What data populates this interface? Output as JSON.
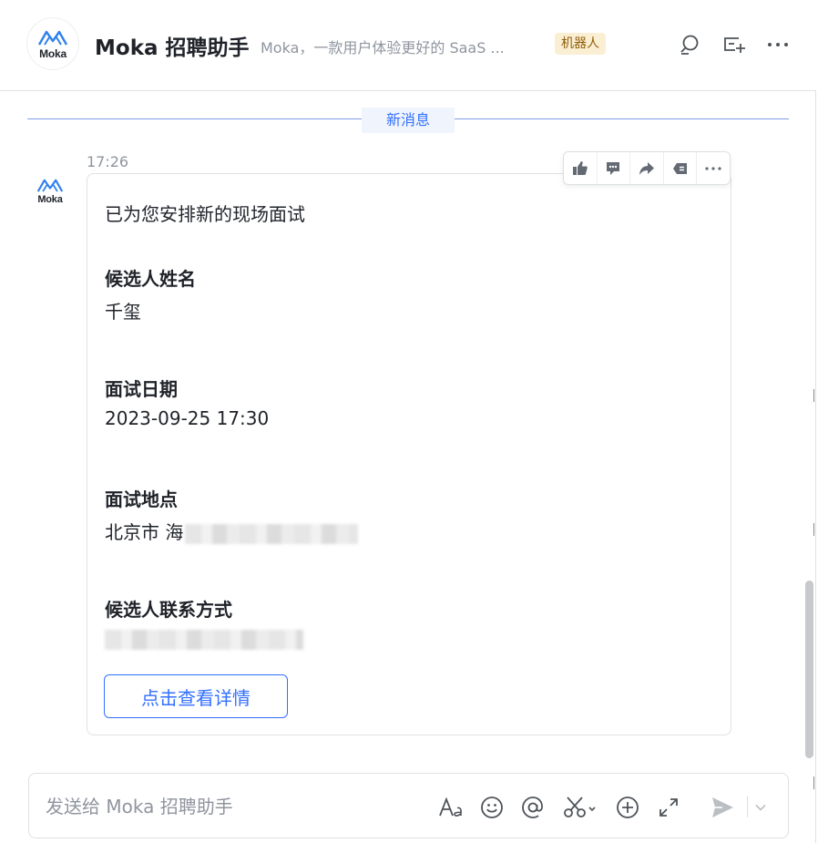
{
  "header": {
    "avatar_text": "Moka",
    "title": "Moka 招聘助手",
    "subtitle": "Moka，一款用户体验更好的 SaaS ...",
    "bot_tag": "机器人"
  },
  "divider": {
    "label": "新消息"
  },
  "message": {
    "avatar_text": "Moka",
    "time": "17:26",
    "intro": "已为您安排新的现场面试",
    "fields": [
      {
        "label": "候选人姓名",
        "value": "千玺"
      },
      {
        "label": "面试日期",
        "value": "2023-09-25 17:30"
      },
      {
        "label": "面试地点",
        "value": "北京市 海"
      },
      {
        "label": "候选人联系方式",
        "value": ""
      }
    ],
    "button_label": "点击查看详情"
  },
  "toolbar_icons": [
    "thumbs-up-icon",
    "reply-icon",
    "forward-icon",
    "flag-icon",
    "more-icon"
  ],
  "composer": {
    "placeholder": "发送给 Moka 招聘助手",
    "icons": [
      "text-format-icon",
      "emoji-icon",
      "mention-icon",
      "scissors-icon",
      "plus-icon",
      "expand-icon",
      "send-icon",
      "chevron-down-icon"
    ]
  },
  "colors": {
    "accent": "#3370ff",
    "tag_bg": "#fbefd3",
    "tag_text": "#8f5e0b",
    "muted": "#8f959e"
  }
}
